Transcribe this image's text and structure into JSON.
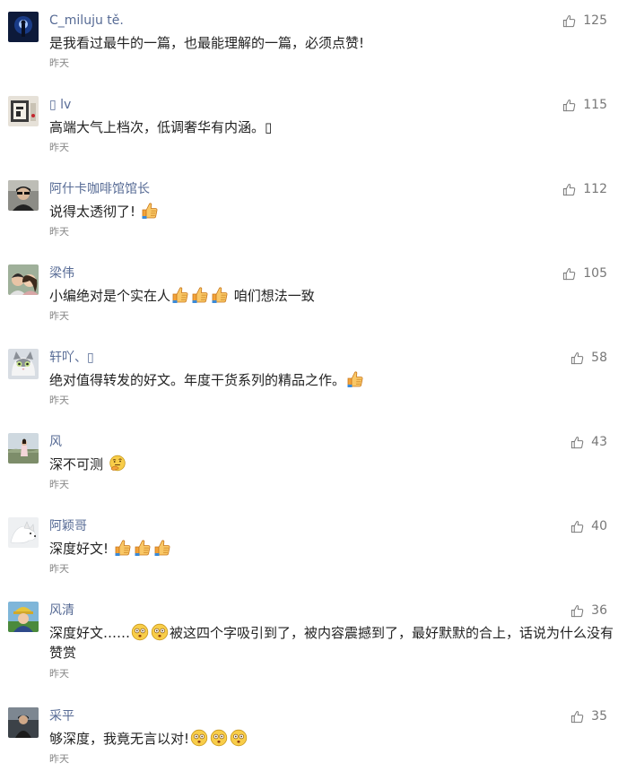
{
  "comments": [
    {
      "name": "C_miluju tě.",
      "text": "是我看过最牛的一篇，也最能理解的一篇，必须点赞!",
      "time": "昨天",
      "likes": "125"
    },
    {
      "name": "▯ lv",
      "text": "高端大气上档次，低调奢华有内涵。▯",
      "time": "昨天",
      "likes": "115"
    },
    {
      "name": "阿什卡咖啡馆馆长",
      "text": "说得太透彻了!",
      "time": "昨天",
      "likes": "112"
    },
    {
      "name": "梁伟",
      "text_a": "小编绝对是个实在人",
      "text_b": "咱们想法一致",
      "time": "昨天",
      "likes": "105"
    },
    {
      "name": "轩吖、▯",
      "text": "绝对值得转发的好文。年度干货系列的精品之作。",
      "time": "昨天",
      "likes": "58"
    },
    {
      "name": "风",
      "text": "深不可测",
      "time": "昨天",
      "likes": "43"
    },
    {
      "name": "阿颖哥",
      "text": "深度好文!",
      "time": "昨天",
      "likes": "40"
    },
    {
      "name": "风清",
      "text_a": "深度好文……",
      "text_b": "被这四个字吸引到了，被内容震撼到了，最好默默的合上，话说为什么没有赞赏",
      "time": "昨天",
      "likes": "36"
    },
    {
      "name": "采平",
      "text": "够深度，我竟无言以对!",
      "time": "昨天",
      "likes": "35"
    }
  ]
}
